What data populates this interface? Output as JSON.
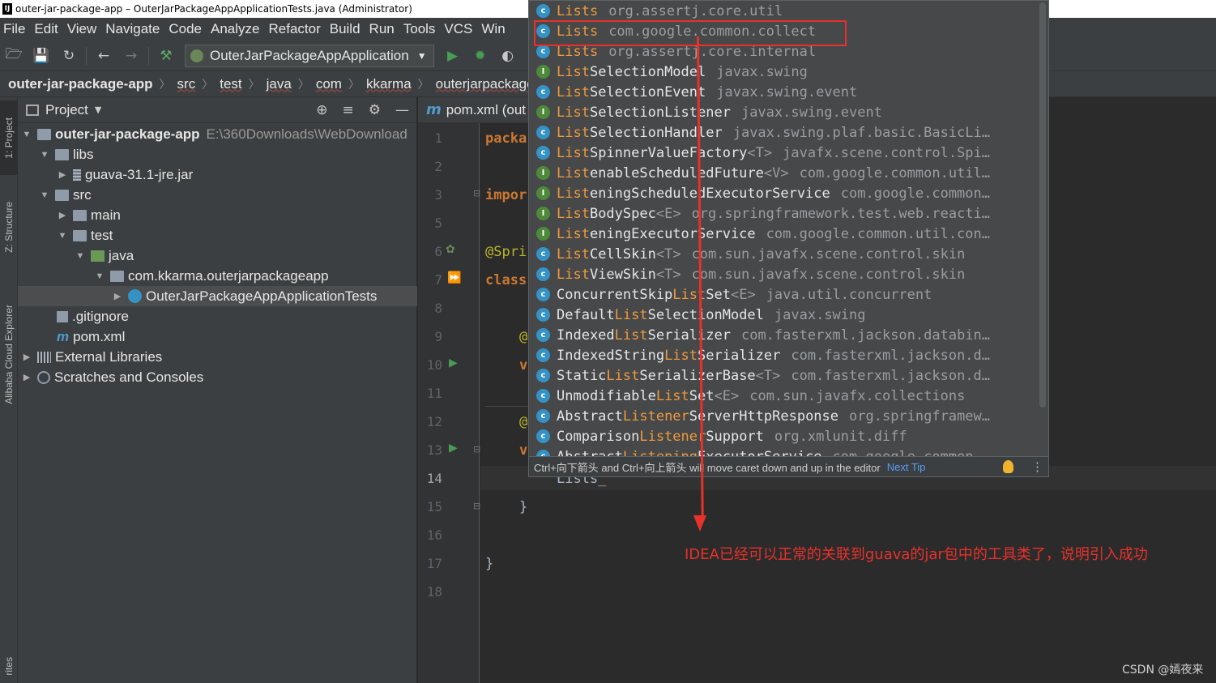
{
  "window": {
    "title": "outer-jar-package-app – OuterJarPackageAppApplicationTests.java (Administrator)"
  },
  "menu": [
    "File",
    "Edit",
    "View",
    "Navigate",
    "Code",
    "Analyze",
    "Refactor",
    "Build",
    "Run",
    "Tools",
    "VCS",
    "Win"
  ],
  "toolbar": {
    "run_config": "OuterJarPackageAppApplication"
  },
  "breadcrumbs": [
    "outer-jar-package-app",
    "src",
    "test",
    "java",
    "com",
    "kkarma",
    "outerjarpackageapp"
  ],
  "left_tabs": [
    "1: Project",
    "Z: Structure",
    "Alibaba Cloud Explorer",
    "rites"
  ],
  "project": {
    "title": "Project",
    "tree": [
      {
        "label": "outer-jar-package-app",
        "path": "E:\\360Downloads\\WebDownload"
      },
      {
        "label": "libs"
      },
      {
        "label": "guava-31.1-jre.jar"
      },
      {
        "label": "src"
      },
      {
        "label": "main"
      },
      {
        "label": "test"
      },
      {
        "label": "java"
      },
      {
        "label": "com.kkarma.outerjarpackageapp"
      },
      {
        "label": "OuterJarPackageAppApplicationTests"
      },
      {
        "label": ".gitignore"
      },
      {
        "label": "pom.xml"
      },
      {
        "label": "External Libraries"
      },
      {
        "label": "Scratches and Consoles"
      }
    ]
  },
  "editor": {
    "tab": "pom.xml (out",
    "line_numbers": [
      "1",
      "2",
      "3",
      "5",
      "6",
      "7",
      "8",
      "9",
      "10",
      "11",
      "12",
      "13",
      "14",
      "15",
      "16",
      "17",
      "18"
    ],
    "code": {
      "l1": "packa",
      "l3": "impor",
      "l6": "@Spri",
      "l7": "class",
      "l9": "@",
      "l10": "v",
      "l12": "@",
      "l13": "v",
      "l14": "Lists_",
      "l15": "}",
      "l17": "}"
    }
  },
  "completion": {
    "items": [
      {
        "kind": "c",
        "pre": "",
        "hl": "Lists",
        "post": "",
        "gen": "",
        "pkg": "org.assertj.core.util"
      },
      {
        "kind": "c",
        "pre": "",
        "hl": "Lists",
        "post": "",
        "gen": "",
        "pkg": "com.google.common.collect"
      },
      {
        "kind": "c",
        "pre": "",
        "hl": "Lists",
        "post": "",
        "gen": "",
        "pkg": "org.assertj.core.internal"
      },
      {
        "kind": "i",
        "pre": "",
        "hl": "List",
        "post": "SelectionModel",
        "gen": "",
        "pkg": "javax.swing"
      },
      {
        "kind": "c",
        "pre": "",
        "hl": "List",
        "post": "SelectionEvent",
        "gen": "",
        "pkg": "javax.swing.event"
      },
      {
        "kind": "i",
        "pre": "",
        "hl": "List",
        "post": "SelectionListener",
        "gen": "",
        "pkg": "javax.swing.event"
      },
      {
        "kind": "c",
        "pre": "",
        "hl": "List",
        "post": "SelectionHandler",
        "gen": "",
        "pkg": "javax.swing.plaf.basic.BasicLi…"
      },
      {
        "kind": "c",
        "pre": "",
        "hl": "List",
        "post": "SpinnerValueFactory",
        "gen": "<T>",
        "pkg": "javafx.scene.control.Spi…"
      },
      {
        "kind": "i",
        "pre": "",
        "hl": "List",
        "post": "enableScheduledFuture",
        "gen": "<V>",
        "pkg": "com.google.common.util…"
      },
      {
        "kind": "i",
        "pre": "",
        "hl": "List",
        "post": "eningScheduledExecutorService",
        "gen": "",
        "pkg": "com.google.common…"
      },
      {
        "kind": "i",
        "pre": "",
        "hl": "List",
        "post": "BodySpec",
        "gen": "<E>",
        "pkg": "org.springframework.test.web.reacti…"
      },
      {
        "kind": "i",
        "pre": "",
        "hl": "List",
        "post": "eningExecutorService",
        "gen": "",
        "pkg": "com.google.common.util.con…"
      },
      {
        "kind": "c",
        "pre": "",
        "hl": "List",
        "post": "CellSkin",
        "gen": "<T>",
        "pkg": "com.sun.javafx.scene.control.skin"
      },
      {
        "kind": "c",
        "pre": "",
        "hl": "List",
        "post": "ViewSkin",
        "gen": "<T>",
        "pkg": "com.sun.javafx.scene.control.skin"
      },
      {
        "kind": "c",
        "pre": "ConcurrentSkip",
        "hl": "List",
        "post": "Set",
        "gen": "<E>",
        "pkg": "java.util.concurrent"
      },
      {
        "kind": "c",
        "pre": "Default",
        "hl": "List",
        "post": "SelectionModel",
        "gen": "",
        "pkg": "javax.swing"
      },
      {
        "kind": "c",
        "pre": "Indexed",
        "hl": "List",
        "post": "Serializer",
        "gen": "",
        "pkg": "com.fasterxml.jackson.databin…"
      },
      {
        "kind": "c",
        "pre": "IndexedString",
        "hl": "List",
        "post": "Serializer",
        "gen": "",
        "pkg": "com.fasterxml.jackson.d…"
      },
      {
        "kind": "c",
        "pre": "Static",
        "hl": "List",
        "post": "SerializerBase",
        "gen": "<T>",
        "pkg": "com.fasterxml.jackson.d…"
      },
      {
        "kind": "c",
        "pre": "Unmodifiable",
        "hl": "List",
        "post": "Set",
        "gen": "<E>",
        "pkg": "com.sun.javafx.collections"
      },
      {
        "kind": "c",
        "pre": "Abstract",
        "hl": "Listener",
        "post": "ServerHttpResponse",
        "gen": "",
        "pkg": "org.springframew…"
      },
      {
        "kind": "c",
        "pre": "Comparison",
        "hl": "Listener",
        "post": "Support",
        "gen": "",
        "pkg": "org.xmlunit.diff"
      },
      {
        "kind": "c",
        "pre": "Abstract",
        "hl": "Listening",
        "post": "ExecutorService",
        "gen": "",
        "pkg": "com.google.common…"
      }
    ],
    "footer": "Ctrl+向下箭头 and Ctrl+向上箭头 will move caret down and up in the editor",
    "next_tip": "Next Tip"
  },
  "annotation": {
    "note": "IDEA已经可以正常的关联到guava的jar包中的工具类了，说明引入成功",
    "color": "#e8312b"
  },
  "watermark": "CSDN @嫣夜来"
}
